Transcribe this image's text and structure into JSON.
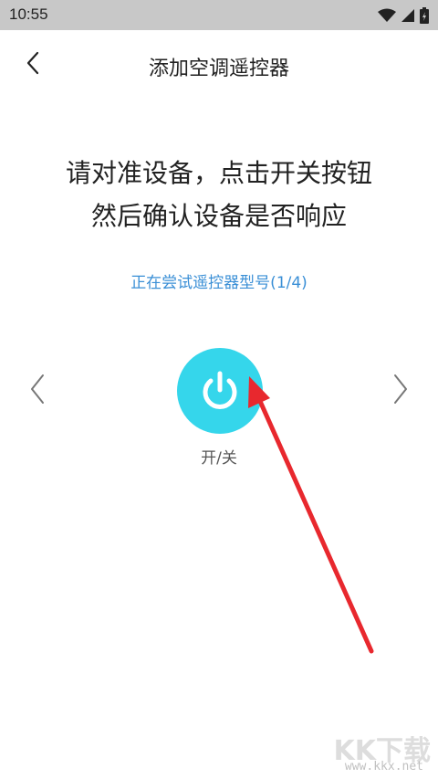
{
  "status_bar": {
    "time": "10:55",
    "icons": [
      "wifi-icon",
      "signal-icon",
      "battery-icon"
    ]
  },
  "header": {
    "title": "添加空调遥控器",
    "back_icon": "chevron-left-icon"
  },
  "instructions": {
    "line1": "请对准设备，点击开关按钮",
    "line2": "然后确认设备是否响应"
  },
  "status_text": "正在尝试遥控器型号(1/4)",
  "power_button": {
    "label": "开/关",
    "icon": "power-icon",
    "color": "#35d6eb"
  },
  "navigation": {
    "prev_icon": "chevron-left-icon",
    "next_icon": "chevron-right-icon"
  },
  "annotation": {
    "icon": "red-arrow-icon",
    "color": "#e8282e"
  },
  "watermark": {
    "main": "KK下载",
    "sub": "www.kkx.net"
  },
  "colors": {
    "status_bar_bg": "#c8c8c8",
    "accent_text": "#3a8fd6"
  }
}
